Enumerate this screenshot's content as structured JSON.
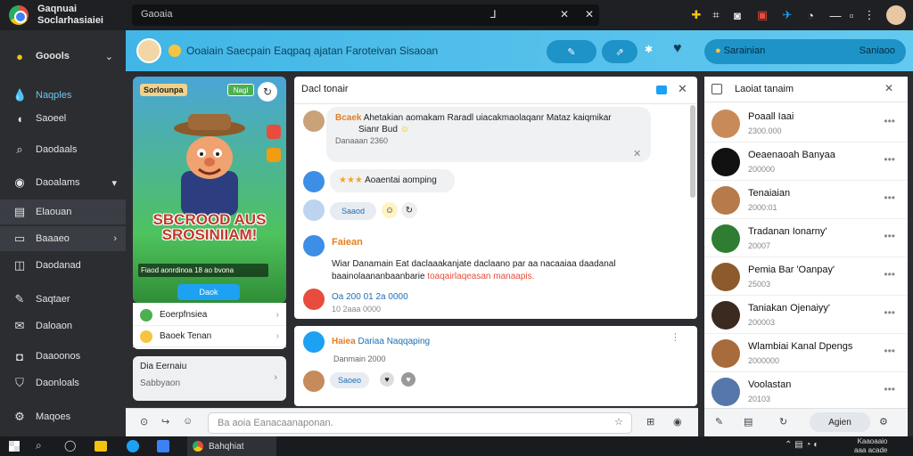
{
  "browser": {
    "title": "Gaqnuai Soclarhasiaiei",
    "omnibox": "Gaoaia",
    "tabs_icons": [
      "pin-icon",
      "close-icon",
      "close-icon"
    ]
  },
  "leftnav": {
    "header": "Goools",
    "items": [
      {
        "label": "Naqples",
        "icon": "drop-icon"
      },
      {
        "label": "Saoeel",
        "icon": "broadcast-icon"
      },
      {
        "label": "Daodaals",
        "icon": "search-icon"
      },
      {
        "label": "Daoalams",
        "icon": "explore-icon"
      },
      {
        "label": "Elaouan",
        "icon": "gallery-icon"
      },
      {
        "label": "Baaaeo",
        "icon": "tv-icon"
      },
      {
        "label": "Daodanad",
        "icon": "app-icon"
      },
      {
        "label": "Saqtaer",
        "icon": "chat-icon"
      },
      {
        "label": "Daloaon",
        "icon": "mail-icon"
      },
      {
        "label": "Daaoonos",
        "icon": "lock-icon"
      },
      {
        "label": "Daonloals",
        "icon": "shield-icon"
      },
      {
        "label": "Maqoes",
        "icon": "settings-icon"
      }
    ]
  },
  "header": {
    "title": "Ooaiain Saecpain Eaqpaq ajatan Faroteivan Sisaoan",
    "search": "Sarainian",
    "search_right": "Saniaoo"
  },
  "game": {
    "tag": "Sorlounpa",
    "badge": "Nagl",
    "title": "SBCROOD AUS SROSINIIAM!",
    "desc": "Fiaod aonrdinoa 18 ao bvona",
    "play": "Daok"
  },
  "side_links": {
    "link1": "Eoerpfnsiea",
    "link2": "Baoek Tenan",
    "section_title": "Dia Eernaiu",
    "section_sub": "Sabbyaon"
  },
  "chat": {
    "title": "Dacl tonair",
    "msg1": {
      "sender": "Bcaek",
      "text": "Ahetakian aomakam Raradl uiacakmaolaqanr Mataz kaiqmikar",
      "text2": "Sianr Bud",
      "meta": "Danaaan  2360"
    },
    "msg2": {
      "text": "Aoaentai aomping",
      "stars": "★★★"
    },
    "msg3": {
      "btn": "Saaod"
    },
    "msg4": {
      "sender": "Faiean",
      "text": "Wiar Danamain Eat daclaaakanjate daclaano par aa nacaaiaa daadanal baainolaananbaanbarie",
      "highlight": "toaqairlaqeasan manaapis.",
      "meta1": "Oa 200 01  2a 0000",
      "meta2": "10 2aaa 0000"
    },
    "msg5": {
      "sender": "Haiea",
      "text": "Dariaa Naqqaping",
      "meta": "Danmain  2000",
      "btn": "Saoeo"
    }
  },
  "composer": {
    "placeholder": "Ba aoia Eanacaanaponan."
  },
  "rightpanel": {
    "title": "Laoiat tanaim",
    "contacts": [
      {
        "name": "Poaall Iaai",
        "sub": "2300.000"
      },
      {
        "name": "Oeaenaoah Banyaa",
        "sub": "200000"
      },
      {
        "name": "Tenaiaian",
        "sub": "2000:01"
      },
      {
        "name": "Tradanan Ionarny'",
        "sub": "20007"
      },
      {
        "name": "Pemia Bar 'Oanpay'",
        "sub": "25003"
      },
      {
        "name": "Taniakan Ojenaiyy'",
        "sub": "200003"
      },
      {
        "name": "Wlambiai Kanal Dpengs",
        "sub": "2000000"
      },
      {
        "name": "Voolastan",
        "sub": "20103"
      }
    ],
    "footer_btn": "Agien"
  },
  "taskbar": {
    "app": "Bahqhiat",
    "time": "Kaaoaaio",
    "date": "aaa acade"
  },
  "colors": {
    "accent": "#41b6e6",
    "dark": "#2b2d31"
  }
}
